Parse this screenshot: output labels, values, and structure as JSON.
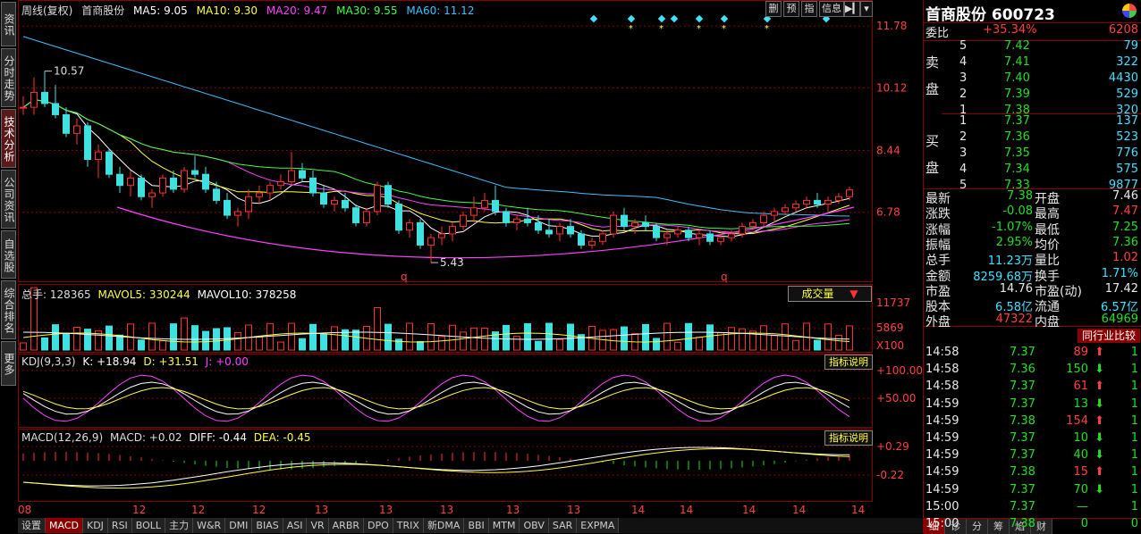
{
  "header": {
    "period": "周线(复权)",
    "stock_name": "首商股份",
    "ma5": "MA5: 9.05",
    "ma10": "MA10: 9.30",
    "ma20": "MA20: 9.47",
    "ma30": "MA30: 9.55",
    "ma60": "MA60: 11.12",
    "toolbar": [
      "删",
      "预",
      "指",
      "信息"
    ]
  },
  "left_tabs": [
    "资讯",
    "分时走势",
    "技术分析",
    "公司资讯",
    "自选股",
    "综合排名",
    "更多"
  ],
  "price_axis": {
    "ticks": [
      "11.78",
      "10.12",
      "8.44",
      "6.78"
    ],
    "high_label": "10.57",
    "low_label": "5.43",
    "markers": [
      "q",
      "q"
    ]
  },
  "volume_panel": {
    "title": "总手: 128365",
    "mavol5": "MAVOL5: 330244",
    "mavol10": "MAVOL10: 378258",
    "dropdown": "成交量",
    "ticks": [
      "11737",
      "5869",
      "X100"
    ]
  },
  "kdj_panel": {
    "title": "KDJ(9,3,3)",
    "k": "K: +18.94",
    "d": "D: +31.51",
    "j": "J: +0.00",
    "button": "指标说明",
    "ticks": [
      "+100.00",
      "+50.00"
    ]
  },
  "macd_panel": {
    "title": "MACD(12,26,9)",
    "macd": "MACD: +0.02",
    "diff": "DIFF: -0.44",
    "dea": "DEA: -0.45",
    "button": "指标说明",
    "ticks": [
      "+0.29",
      "-0.22"
    ]
  },
  "x_axis": [
    "08",
    "12",
    "12",
    "12",
    "13",
    "13",
    "13",
    "13",
    "13",
    "14",
    "14",
    "14",
    "14",
    "14"
  ],
  "bottom_tabs": [
    "设置",
    "MACD",
    "KDJ",
    "RSI",
    "BOLL",
    "主力",
    "W&R",
    "DMI",
    "BIAS",
    "ASI",
    "VR",
    "ARBR",
    "DPO",
    "TRIX",
    "新DMA",
    "BBI",
    "MTM",
    "OBV",
    "SAR",
    "EXPMA"
  ],
  "quote": {
    "title": "首商股份 600723",
    "weibi_label": "委比",
    "weibi_pct": "+35.34%",
    "weibi_val": "6208",
    "sell_label": [
      "卖",
      "盘"
    ],
    "buy_label": [
      "买",
      "盘"
    ],
    "sell": [
      {
        "lvl": "5",
        "price": "7.42",
        "vol": "79"
      },
      {
        "lvl": "4",
        "price": "7.41",
        "vol": "322"
      },
      {
        "lvl": "3",
        "price": "7.40",
        "vol": "4430"
      },
      {
        "lvl": "2",
        "price": "7.39",
        "vol": "529"
      },
      {
        "lvl": "1",
        "price": "7.38",
        "vol": "320"
      }
    ],
    "buy": [
      {
        "lvl": "1",
        "price": "7.37",
        "vol": "137"
      },
      {
        "lvl": "2",
        "price": "7.36",
        "vol": "523"
      },
      {
        "lvl": "3",
        "price": "7.35",
        "vol": "776"
      },
      {
        "lvl": "4",
        "price": "7.34",
        "vol": "575"
      },
      {
        "lvl": "5",
        "price": "7.33",
        "vol": "9877"
      }
    ],
    "stats": [
      {
        "l1": "最新",
        "v1": "7.38",
        "c1": "green",
        "l2": "开盘",
        "v2": "7.46",
        "c2": "white"
      },
      {
        "l1": "涨跌",
        "v1": "-0.08",
        "c1": "green",
        "l2": "最高",
        "v2": "7.47",
        "c2": "red"
      },
      {
        "l1": "涨幅",
        "v1": "-1.07%",
        "c1": "green",
        "l2": "最低",
        "v2": "7.25",
        "c2": "green"
      },
      {
        "l1": "振幅",
        "v1": "2.95%",
        "c1": "green",
        "l2": "均价",
        "v2": "7.36",
        "c2": "green"
      },
      {
        "l1": "总手",
        "v1": "11.23万",
        "c1": "cyan",
        "l2": "量比",
        "v2": "1.02",
        "c2": "red"
      },
      {
        "l1": "金额",
        "v1": "8259.68万",
        "c1": "cyan",
        "l2": "换手",
        "v2": "1.71%",
        "c2": "cyan"
      },
      {
        "l1": "市盈",
        "v1": "14.76",
        "c1": "white",
        "l2": "市盈(动)",
        "v2": "17.42",
        "c2": "white"
      },
      {
        "l1": "股本",
        "v1": "6.58亿",
        "c1": "cyan",
        "l2": "流通",
        "v2": "6.57亿",
        "c2": "cyan"
      },
      {
        "l1": "外盘",
        "v1": "47322",
        "c1": "red",
        "l2": "内盘",
        "v2": "64969",
        "c2": "green"
      }
    ],
    "compare_button": "同行业比较",
    "trades": [
      {
        "t": "14:58",
        "p": "7.37",
        "v": "89",
        "d": "up",
        "n": "1"
      },
      {
        "t": "14:58",
        "p": "7.36",
        "v": "150",
        "d": "down",
        "n": "1"
      },
      {
        "t": "14:58",
        "p": "7.37",
        "v": "61",
        "d": "up",
        "n": "1"
      },
      {
        "t": "14:59",
        "p": "7.37",
        "v": "13",
        "d": "down",
        "n": "1"
      },
      {
        "t": "14:59",
        "p": "7.38",
        "v": "154",
        "d": "up",
        "n": "1"
      },
      {
        "t": "14:59",
        "p": "7.37",
        "v": "10",
        "d": "down",
        "n": "1"
      },
      {
        "t": "14:59",
        "p": "7.37",
        "v": "40",
        "d": "down",
        "n": "1"
      },
      {
        "t": "14:59",
        "p": "7.38",
        "v": "15",
        "d": "up",
        "n": "1"
      },
      {
        "t": "14:59",
        "p": "7.37",
        "v": "70",
        "d": "down",
        "n": "1"
      },
      {
        "t": "15:00",
        "p": "7.37",
        "v": "—",
        "d": "none",
        "n": "1"
      },
      {
        "t": "15:00",
        "p": "7.38",
        "v": "0",
        "d": "none",
        "n": "0"
      }
    ],
    "tabs": [
      "细",
      "诊",
      "分",
      "筹",
      "焰",
      "财"
    ]
  },
  "chart_data": {
    "type": "candlestick",
    "series_note": "weekly candles",
    "price": {
      "ylim": [
        5.0,
        12.0
      ],
      "ma_colors": {
        "ma5": "#ffffff",
        "ma10": "#ffff40",
        "ma20": "#ff40ff",
        "ma30": "#40ff40",
        "ma60": "#40c0ff"
      }
    },
    "candles": [
      [
        9.6,
        9.9,
        9.4,
        9.6
      ],
      [
        9.6,
        10.4,
        9.4,
        10.0
      ],
      [
        10.0,
        10.57,
        9.6,
        9.7
      ],
      [
        9.7,
        10.2,
        9.3,
        9.4
      ],
      [
        9.4,
        9.6,
        8.8,
        8.9
      ],
      [
        8.9,
        9.3,
        8.6,
        9.1
      ],
      [
        9.1,
        9.2,
        8.0,
        8.2
      ],
      [
        8.2,
        8.6,
        7.7,
        8.4
      ],
      [
        8.4,
        8.5,
        7.7,
        7.8
      ],
      [
        7.8,
        8.0,
        7.3,
        7.5
      ],
      [
        7.5,
        7.9,
        7.2,
        7.7
      ],
      [
        7.7,
        7.8,
        7.1,
        7.2
      ],
      [
        7.2,
        7.4,
        6.9,
        7.3
      ],
      [
        7.3,
        7.8,
        7.2,
        7.7
      ],
      [
        7.7,
        7.9,
        7.3,
        7.4
      ],
      [
        7.4,
        8.0,
        7.3,
        7.9
      ],
      [
        7.9,
        8.3,
        7.7,
        7.8
      ],
      [
        7.8,
        8.0,
        7.3,
        7.4
      ],
      [
        7.4,
        7.6,
        7.0,
        7.1
      ],
      [
        7.1,
        7.3,
        6.6,
        6.7
      ],
      [
        6.7,
        6.9,
        6.4,
        6.8
      ],
      [
        6.8,
        7.4,
        6.6,
        7.2
      ],
      [
        7.2,
        7.5,
        7.0,
        7.3
      ],
      [
        7.3,
        7.6,
        7.1,
        7.5
      ],
      [
        7.5,
        7.8,
        7.4,
        7.6
      ],
      [
        7.6,
        8.4,
        7.5,
        7.9
      ],
      [
        7.9,
        8.1,
        7.6,
        7.7
      ],
      [
        7.7,
        7.9,
        7.2,
        7.3
      ],
      [
        7.3,
        7.5,
        6.9,
        7.0
      ],
      [
        7.0,
        7.2,
        6.8,
        7.1
      ],
      [
        7.1,
        7.3,
        6.8,
        6.9
      ],
      [
        6.9,
        7.0,
        6.4,
        6.5
      ],
      [
        6.5,
        6.9,
        6.4,
        6.8
      ],
      [
        6.8,
        7.6,
        6.7,
        7.5
      ],
      [
        7.5,
        7.6,
        6.9,
        7.0
      ],
      [
        7.0,
        7.1,
        6.2,
        6.3
      ],
      [
        6.3,
        6.6,
        6.1,
        6.5
      ],
      [
        6.5,
        6.6,
        5.8,
        5.9
      ],
      [
        5.9,
        6.2,
        5.43,
        6.1
      ],
      [
        6.1,
        6.4,
        5.9,
        6.2
      ],
      [
        6.2,
        6.5,
        6.0,
        6.4
      ],
      [
        6.4,
        6.8,
        6.3,
        6.7
      ],
      [
        6.7,
        7.2,
        6.5,
        6.9
      ],
      [
        6.9,
        7.3,
        6.8,
        7.1
      ],
      [
        7.1,
        7.5,
        6.7,
        6.8
      ],
      [
        6.8,
        6.9,
        6.4,
        6.5
      ],
      [
        6.5,
        6.7,
        6.3,
        6.6
      ],
      [
        6.6,
        6.9,
        6.4,
        6.5
      ],
      [
        6.5,
        6.7,
        6.2,
        6.3
      ],
      [
        6.3,
        6.6,
        6.1,
        6.2
      ],
      [
        6.2,
        6.5,
        6.0,
        6.4
      ],
      [
        6.4,
        6.6,
        6.1,
        6.2
      ],
      [
        6.2,
        6.3,
        5.8,
        5.9
      ],
      [
        5.9,
        6.1,
        5.8,
        6.0
      ],
      [
        6.0,
        6.3,
        5.9,
        6.2
      ],
      [
        6.2,
        6.8,
        6.1,
        6.7
      ],
      [
        6.7,
        6.9,
        6.3,
        6.4
      ],
      [
        6.4,
        6.6,
        6.2,
        6.5
      ],
      [
        6.5,
        6.7,
        6.3,
        6.4
      ],
      [
        6.4,
        6.5,
        6.0,
        6.1
      ],
      [
        6.1,
        6.3,
        5.9,
        6.2
      ],
      [
        6.2,
        6.4,
        6.1,
        6.3
      ],
      [
        6.3,
        6.4,
        6.0,
        6.1
      ],
      [
        6.1,
        6.3,
        5.9,
        6.2
      ],
      [
        6.2,
        6.3,
        5.9,
        6.0
      ],
      [
        6.0,
        6.2,
        5.9,
        6.1
      ],
      [
        6.1,
        6.3,
        6.0,
        6.2
      ],
      [
        6.2,
        6.5,
        6.1,
        6.4
      ],
      [
        6.4,
        6.6,
        6.3,
        6.5
      ],
      [
        6.5,
        6.8,
        6.4,
        6.7
      ],
      [
        6.7,
        6.9,
        6.5,
        6.8
      ],
      [
        6.8,
        7.0,
        6.7,
        6.9
      ],
      [
        6.9,
        7.1,
        6.8,
        7.0
      ],
      [
        7.0,
        7.2,
        6.9,
        7.1
      ],
      [
        7.1,
        7.3,
        6.9,
        7.0
      ],
      [
        7.0,
        7.2,
        6.8,
        7.1
      ],
      [
        7.1,
        7.3,
        7.0,
        7.2
      ],
      [
        7.2,
        7.47,
        7.1,
        7.38
      ]
    ]
  }
}
